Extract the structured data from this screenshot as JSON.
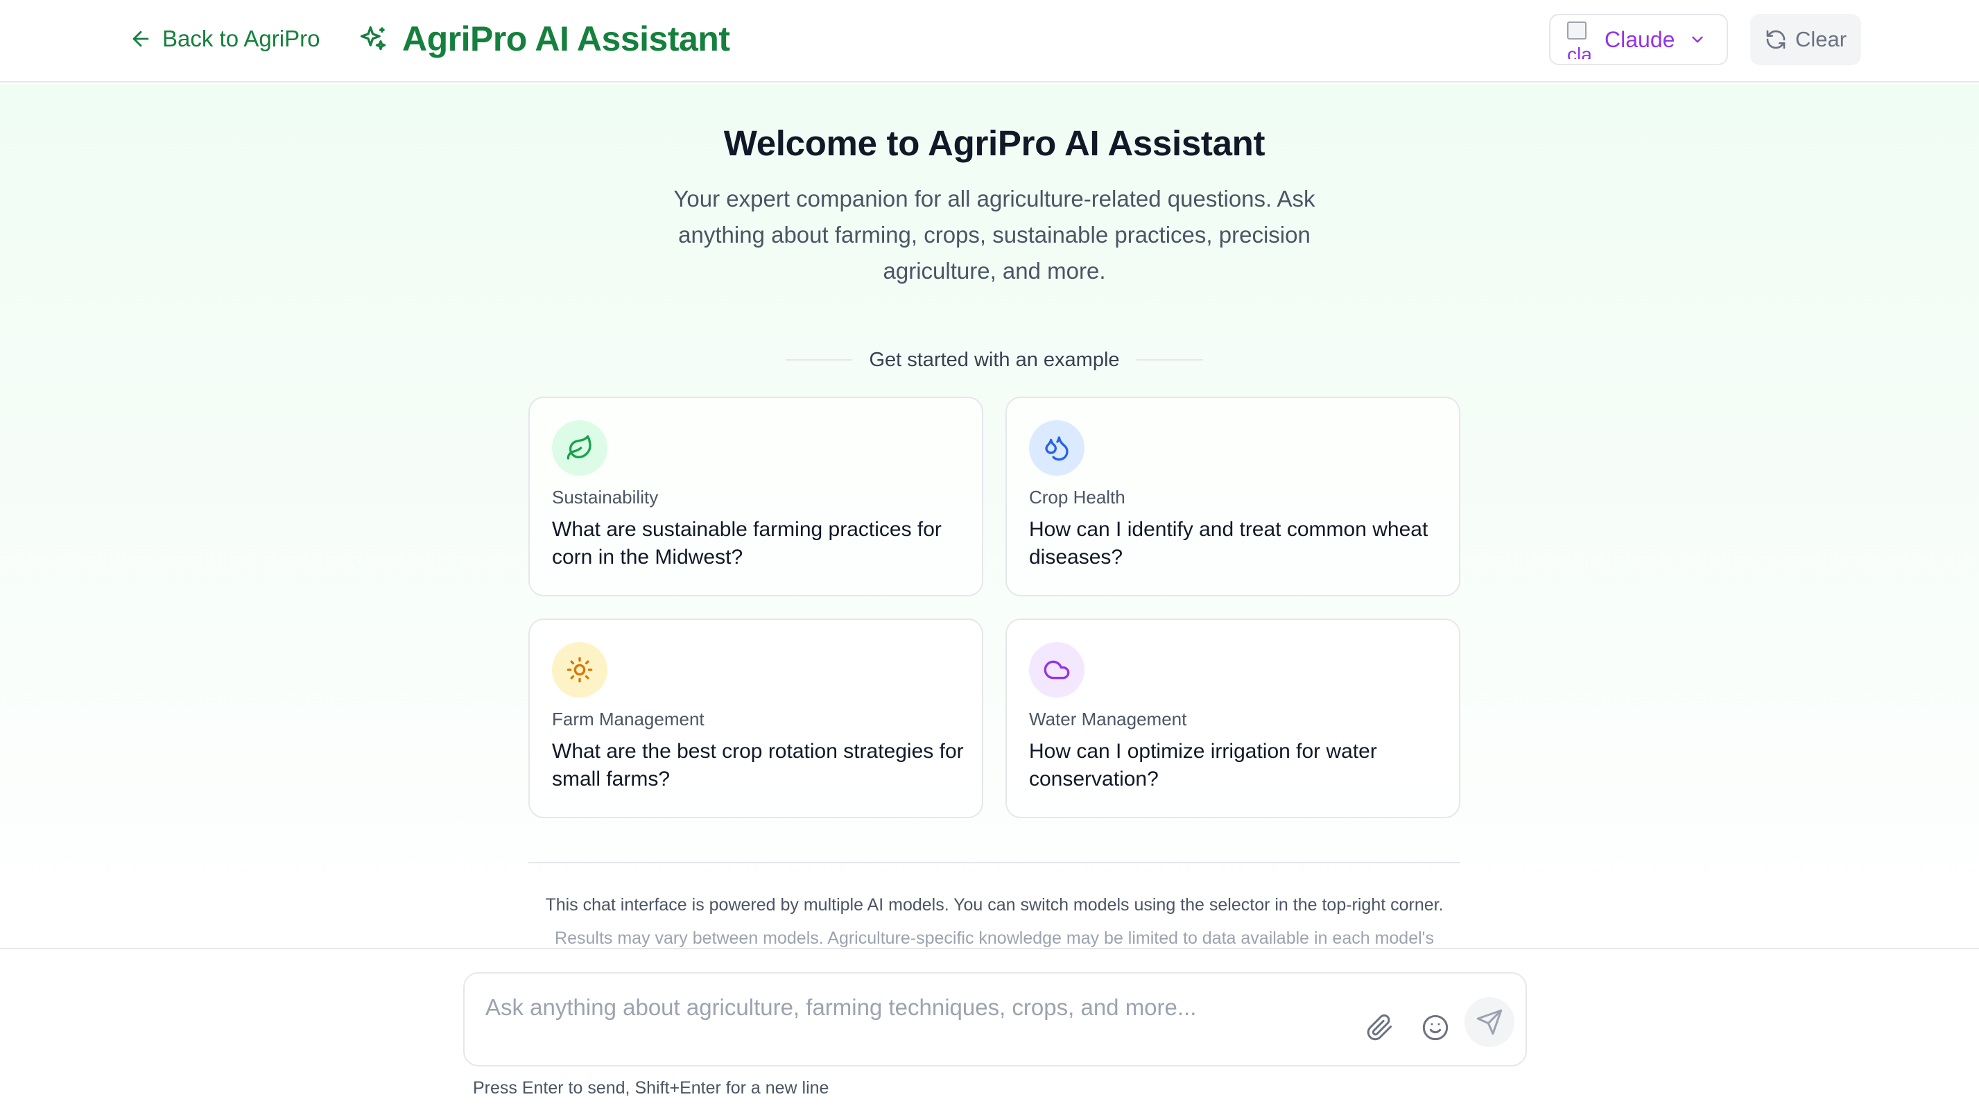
{
  "header": {
    "back_label": "Back to AgriPro",
    "title": "AgriPro AI Assistant",
    "model_selector": {
      "selected": "Claude",
      "logo_alt": "cla"
    },
    "clear_label": "Clear"
  },
  "welcome": {
    "title": "Welcome to AgriPro AI Assistant",
    "subtitle": "Your expert companion for all agriculture-related questions. Ask anything about farming, crops, sustainable practices, precision agriculture, and more.",
    "examples_heading": "Get started with an example"
  },
  "examples": [
    {
      "category": "Sustainability",
      "question": "What are sustainable farming practices for corn in the Midwest?",
      "icon": "leaf-icon",
      "color": "#16a34a",
      "bg": "#dcfce7"
    },
    {
      "category": "Crop Health",
      "question": "How can I identify and treat common wheat diseases?",
      "icon": "droplets-icon",
      "color": "#2563eb",
      "bg": "#dbeafe"
    },
    {
      "category": "Farm Management",
      "question": "What are the best crop rotation strategies for small farms?",
      "icon": "sun-icon",
      "color": "#d97706",
      "bg": "#fef3c7"
    },
    {
      "category": "Water Management",
      "question": "How can I optimize irrigation for water conservation?",
      "icon": "cloud-icon",
      "color": "#9333ea",
      "bg": "#f3e8ff"
    }
  ],
  "disclaimer": {
    "line1": "This chat interface is powered by multiple AI models. You can switch models using the selector in the top-right corner.",
    "line2": "Results may vary between models. Agriculture-specific knowledge may be limited to data available in each model's"
  },
  "composer": {
    "placeholder": "Ask anything about agriculture, farming techniques, crops, and more...",
    "value": "",
    "hint": "Press Enter to send, Shift+Enter for a new line"
  },
  "colors": {
    "brand": "#15803d",
    "model_accent": "#9333ea"
  }
}
